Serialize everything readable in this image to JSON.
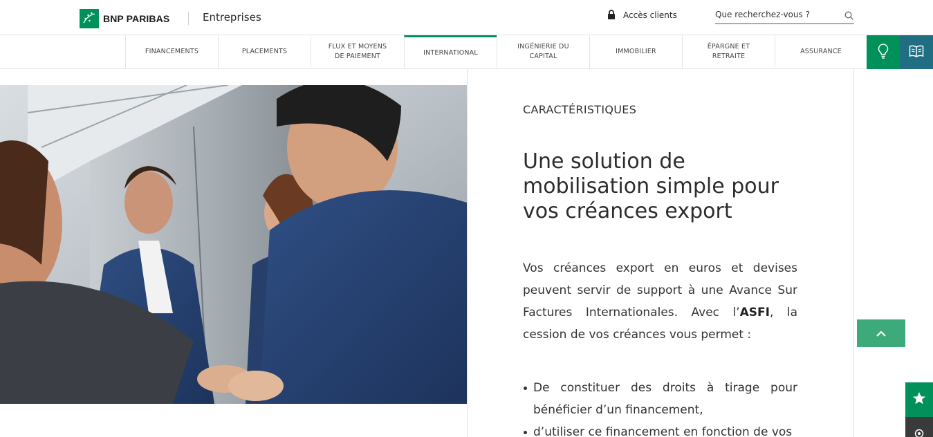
{
  "header": {
    "brand_name": "BNP PARIBAS",
    "brand_sub": "Entreprises",
    "client_access": "Accès clients",
    "search_placeholder": "Que recherchez-vous ?"
  },
  "nav": {
    "items": [
      {
        "label": "FINANCEMENTS"
      },
      {
        "label": "PLACEMENTS"
      },
      {
        "label": "FLUX ET MOYENS DE PAIEMENT"
      },
      {
        "label": "INTERNATIONAL",
        "active": true
      },
      {
        "label": "INGÉNIERIE DU CAPITAL"
      },
      {
        "label": "IMMOBILIER"
      },
      {
        "label": "ÉPARGNE ET RETRAITE"
      },
      {
        "label": "ASSURANCE"
      }
    ],
    "icon_buttons": [
      "lightbulb-icon",
      "book-icon"
    ]
  },
  "content": {
    "eyebrow": "CARACTÉRISTIQUES",
    "heading": "Une solution de mobilisation simple pour vos créances export",
    "para_before": "Vos créances export en euros et devises peuvent servir de support à une Avance Sur Factures Internationales. Avec l’",
    "para_bold": "ASFI",
    "para_after": ",  la cession de vos créances vous permet :",
    "bullets": [
      "De constituer des droits à tirage pour bénéficier d’un financement,",
      "d’utiliser ce financement en fonction de vos"
    ]
  },
  "colors": {
    "brand_green": "#00915a",
    "teal": "#1f6e82",
    "scroll_green": "#3daa7c"
  }
}
